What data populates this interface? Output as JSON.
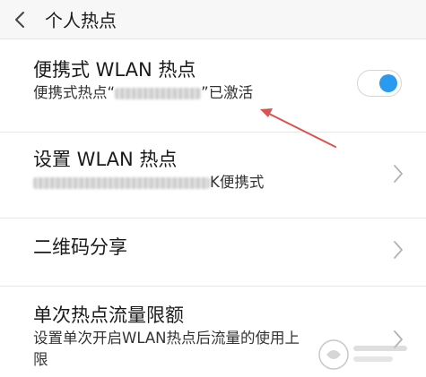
{
  "header": {
    "title": "个人热点"
  },
  "items": [
    {
      "title": "便携式 WLAN 热点",
      "subtitle_prefix": "便携式热点“",
      "subtitle_suffix": "”已激活",
      "toggle_on": true
    },
    {
      "title": "设置 WLAN 热点",
      "subtitle_suffix": "K便携式"
    },
    {
      "title": "二维码分享"
    },
    {
      "title": "单次热点流量限额",
      "subtitle_line1": "设置单次开启WLAN热点后流量的使用上",
      "subtitle_line2": "限"
    }
  ],
  "colors": {
    "accent": "#2a9af0",
    "annotation_arrow": "#d9534f",
    "header_bg": "#f7f7f7"
  },
  "icons": {
    "back": "chevron-left-icon",
    "chevron": "chevron-right-icon"
  }
}
